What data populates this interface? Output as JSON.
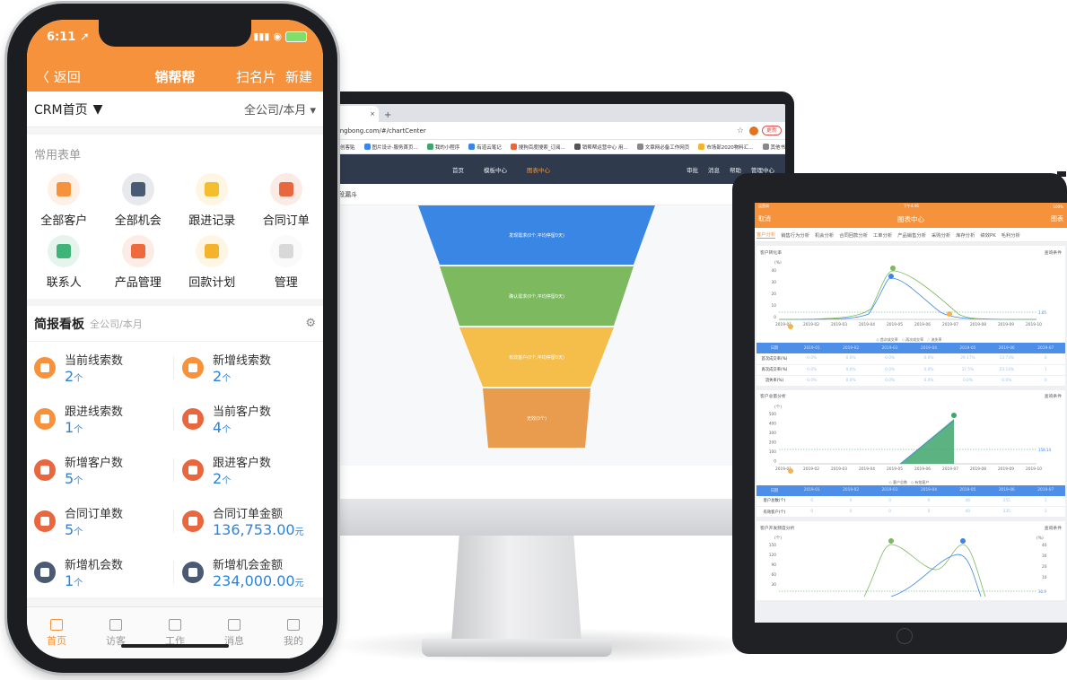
{
  "monitor": {
    "browser": {
      "tab_close": "×",
      "new_tab": "+",
      "url": "bongbong.com/#/chartCenter",
      "update_label": "更新",
      "bookmarks": [
        "创客贴",
        "图片设计-服务首页...",
        "我的小程序",
        "有道云笔记",
        "搜狗百度搜索_订阅...",
        "销帮帮运营中心 用...",
        "文章网必备工作网页",
        "市场部2020物料汇...",
        "其他书签"
      ]
    },
    "nav": {
      "center": [
        "首页",
        "模板中心",
        "图表中心"
      ],
      "right": [
        "审批",
        "消息",
        "帮助",
        "管理中心"
      ]
    },
    "breadcrumb": "阶段漏斗",
    "funnel": [
      {
        "label": "发现需求(0个,平均停留0天)",
        "color": "#3a86e4"
      },
      {
        "label": "确认需求(0个,平均停留0天)",
        "color": "#7cb95f"
      },
      {
        "label": "有效客户(0个,平均停留0天)",
        "color": "#f5be4b"
      },
      {
        "label": "无效(0个)",
        "color": "#e99c4d"
      }
    ]
  },
  "tablet": {
    "status": {
      "left": "运营商",
      "center": "下午4:46",
      "right": "100%"
    },
    "header": {
      "cancel": "取消",
      "title": "图表中心",
      "right": "图表"
    },
    "tabs": [
      "客户分析",
      "销售行为分析",
      "机会分析",
      "合同回款分析",
      "工单分析",
      "产品销售分析",
      "采购分析",
      "库存分析",
      "绩效PK",
      "毛利分析"
    ],
    "query_label": "查询条件",
    "cards": [
      {
        "title": "客户转化率",
        "unit": "(%)",
        "y_ticks": [
          "40",
          "30",
          "20",
          "10",
          "0"
        ],
        "x_ticks": [
          "2019-01",
          "2019-02",
          "2019-03",
          "2019-04",
          "2019-05",
          "2019-06",
          "2019-07",
          "2019-08",
          "2019-09",
          "2019-10"
        ],
        "legend": [
          "首次成交率",
          "再次成交率",
          "流失率"
        ],
        "table_head": [
          "日期",
          "2019-01",
          "2019-02",
          "2019-03",
          "2019-04",
          "2019-05",
          "2019-06",
          "2019-07"
        ],
        "rows": [
          {
            "label": "首次成交率(%)",
            "values": [
              "0.0%",
              "0.0%",
              "0.0%",
              "0.0%",
              "29.17%",
              "13.73%",
              "0"
            ]
          },
          {
            "label": "再次成交率(%)",
            "values": [
              "0.0%",
              "0.0%",
              "0.0%",
              "0.0%",
              "37.5%",
              "23.14%",
              "1"
            ]
          },
          {
            "label": "流失率(%)",
            "values": [
              "0.0%",
              "0.0%",
              "0.0%",
              "0.0%",
              "0.0%",
              "0.0%",
              "0"
            ]
          }
        ],
        "ref_value": "1.05"
      },
      {
        "title": "客户总量分析",
        "unit": "(个)",
        "y_ticks": [
          "500",
          "400",
          "300",
          "200",
          "100",
          "0"
        ],
        "x_ticks": [
          "2019-01",
          "2019-02",
          "2019-03",
          "2019-04",
          "2019-05",
          "2019-06",
          "2019-07",
          "2019-08",
          "2019-09",
          "2019-10"
        ],
        "legend": [
          "客户总数",
          "有效客户"
        ],
        "table_head": [
          "日期",
          "2019-01",
          "2019-02",
          "2019-03",
          "2019-04",
          "2019-05",
          "2019-06",
          "2019-07"
        ],
        "rows": [
          {
            "label": "客户总数(个)",
            "values": [
              "0",
              "0",
              "0",
              "0",
              "46",
              "255",
              "2"
            ]
          },
          {
            "label": "有效客户(个)",
            "values": [
              "0",
              "0",
              "0",
              "0",
              "40",
              "235",
              "2"
            ]
          }
        ],
        "ref_value": "158.14"
      },
      {
        "title": "客户开发频度分析",
        "unit": "(个)",
        "unit_right": "(%)",
        "y_ticks": [
          "150",
          "120",
          "90",
          "60",
          "30"
        ],
        "y_ticks_right": [
          "40",
          "30",
          "20",
          "10"
        ],
        "ref_value": "30.9"
      }
    ]
  },
  "phone": {
    "status_time": "6:11",
    "nav": {
      "back": "返回",
      "title": "销帮帮",
      "scan": "扫名片",
      "new": "新建"
    },
    "crm_title": "CRM首页",
    "scope": "全公司/本月",
    "common_forms_title": "常用表单",
    "forms": [
      {
        "label": "全部客户",
        "color": "#f6923c"
      },
      {
        "label": "全部机会",
        "color": "#4a5a73"
      },
      {
        "label": "跟进记录",
        "color": "#f5be2e"
      },
      {
        "label": "合同订单",
        "color": "#e8673f"
      },
      {
        "label": "联系人",
        "color": "#3fb37a"
      },
      {
        "label": "产品管理",
        "color": "#ee6a3c"
      },
      {
        "label": "回款计划",
        "color": "#f5b32b"
      },
      {
        "label": "管理",
        "color": "#d8d8d8"
      }
    ],
    "board_title": "简报看板",
    "board_scope": "全公司/本月",
    "stats": [
      {
        "label": "当前线索数",
        "value": "2",
        "unit": "个",
        "color": "#f6923c"
      },
      {
        "label": "新增线索数",
        "value": "2",
        "unit": "个",
        "color": "#f6923c"
      },
      {
        "label": "跟进线索数",
        "value": "1",
        "unit": "个",
        "color": "#f6923c"
      },
      {
        "label": "当前客户数",
        "value": "4",
        "unit": "个",
        "color": "#e8673f"
      },
      {
        "label": "新增客户数",
        "value": "5",
        "unit": "个",
        "color": "#e8673f"
      },
      {
        "label": "跟进客户数",
        "value": "2",
        "unit": "个",
        "color": "#e8673f"
      },
      {
        "label": "合同订单数",
        "value": "5",
        "unit": "个",
        "color": "#e8673f"
      },
      {
        "label": "合同订单金额",
        "value": "136,753.00",
        "unit": "元",
        "color": "#e8673f"
      },
      {
        "label": "新增机会数",
        "value": "1",
        "unit": "个",
        "color": "#4a5a73"
      },
      {
        "label": "新增机会金额",
        "value": "234,000.00",
        "unit": "元",
        "color": "#4a5a73"
      }
    ],
    "tabbar": [
      "首页",
      "访客",
      "工作",
      "消息",
      "我的"
    ]
  }
}
